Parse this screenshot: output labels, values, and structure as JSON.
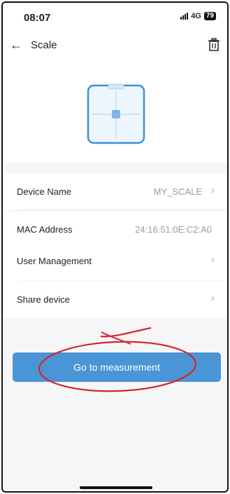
{
  "status_bar": {
    "time": "08:07",
    "network": "4G",
    "battery": "79"
  },
  "header": {
    "title": "Scale",
    "back_icon": "arrow-left-icon",
    "delete_icon": "trash-icon"
  },
  "device": {
    "icon": "scale-device-icon"
  },
  "info_rows": [
    {
      "label": "Device Name",
      "value": "MY_SCALE"
    },
    {
      "label": "MAC Address",
      "value": "24:16:51:0E:C2:A0"
    }
  ],
  "menu_rows": [
    {
      "label": "User Management"
    },
    {
      "label": "Share device"
    }
  ],
  "primary_button": {
    "label": "Go to measurement"
  },
  "colors": {
    "accent": "#4a95d6",
    "background": "#f6f6f8",
    "annotation": "#d6262b"
  }
}
